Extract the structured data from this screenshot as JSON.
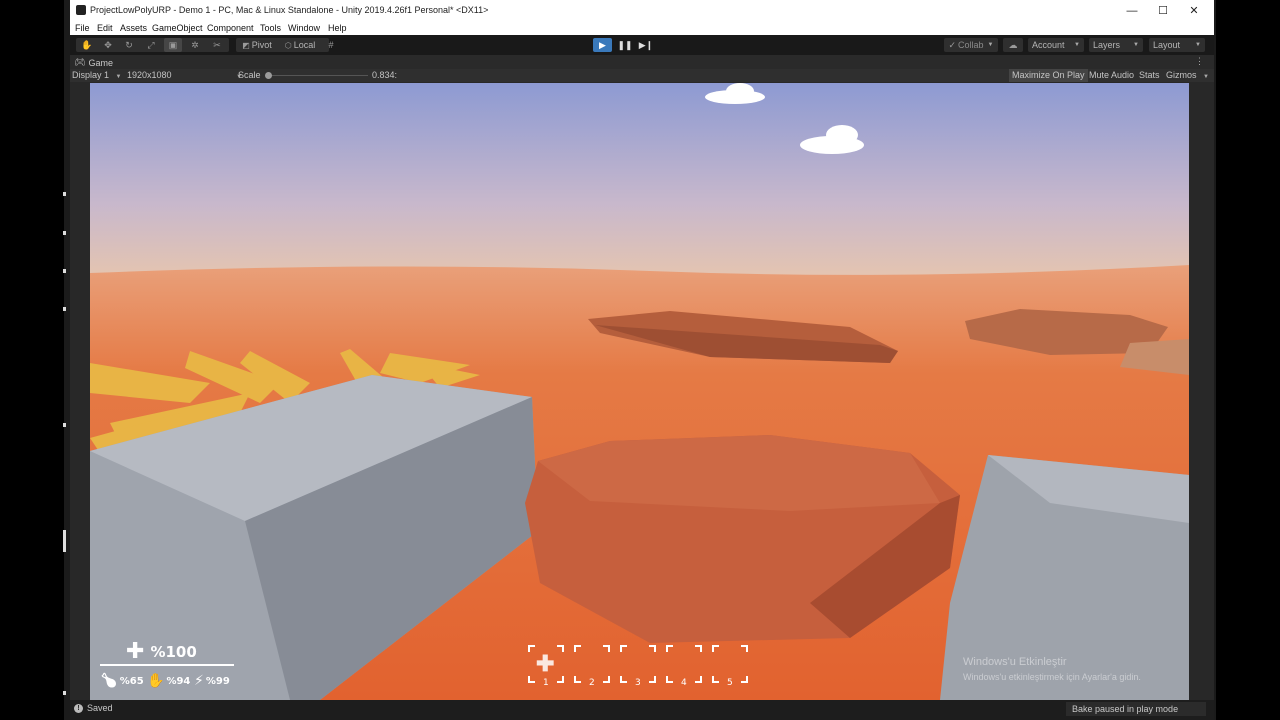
{
  "window": {
    "title": "ProjectLowPolyURP - Demo 1 - PC, Mac & Linux Standalone - Unity 2019.4.26f1 Personal* <DX11>",
    "controls": {
      "minimize": "—",
      "maximize": "☐",
      "close": "✕"
    }
  },
  "menu": [
    "File",
    "Edit",
    "Assets",
    "GameObject",
    "Component",
    "Tools",
    "Window",
    "Help"
  ],
  "toolbar": {
    "tools": [
      "hand-tool",
      "move-tool",
      "rotate-tool",
      "scale-tool",
      "rect-tool",
      "transform-tool",
      "custom-tool"
    ],
    "active_tool": "rect-tool",
    "pivot_label": "Pivot",
    "local_label": "Local",
    "collab_label": "Collab",
    "account_label": "Account",
    "layers_label": "Layers",
    "layout_label": "Layout",
    "play_state": "playing"
  },
  "game_view": {
    "tab_label": "Game",
    "display": "Display 1",
    "resolution": "1920x1080",
    "scale_label": "Scale",
    "scale_value": "0.834:",
    "maximize_on_play": "Maximize On Play",
    "mute_audio": "Mute Audio",
    "stats": "Stats",
    "gizmos": "Gizmos"
  },
  "hud": {
    "health": "%100",
    "stats": [
      {
        "icon": "drumstick-icon",
        "value": "%65"
      },
      {
        "icon": "hand-icon",
        "value": "%94"
      },
      {
        "icon": "lightning-icon",
        "value": "%99"
      }
    ],
    "slots": [
      "1",
      "2",
      "3",
      "4",
      "5"
    ],
    "selected_slot": 1
  },
  "watermark": {
    "title": "Windows'u Etkinleştir",
    "subtitle": "Windows'u etkinleştirmek için Ayarlar'a gidin."
  },
  "status": {
    "saved": "Saved",
    "bake": "Bake paused in play mode"
  },
  "colors": {
    "sky_top": "#8d9ad2",
    "sky_bottom": "#efc9a6",
    "sand": "#e36b36",
    "rock": "#c45f3c",
    "stone": "#a3a8b0",
    "unity_dark": "#282828",
    "play_active": "#3a79bb"
  }
}
